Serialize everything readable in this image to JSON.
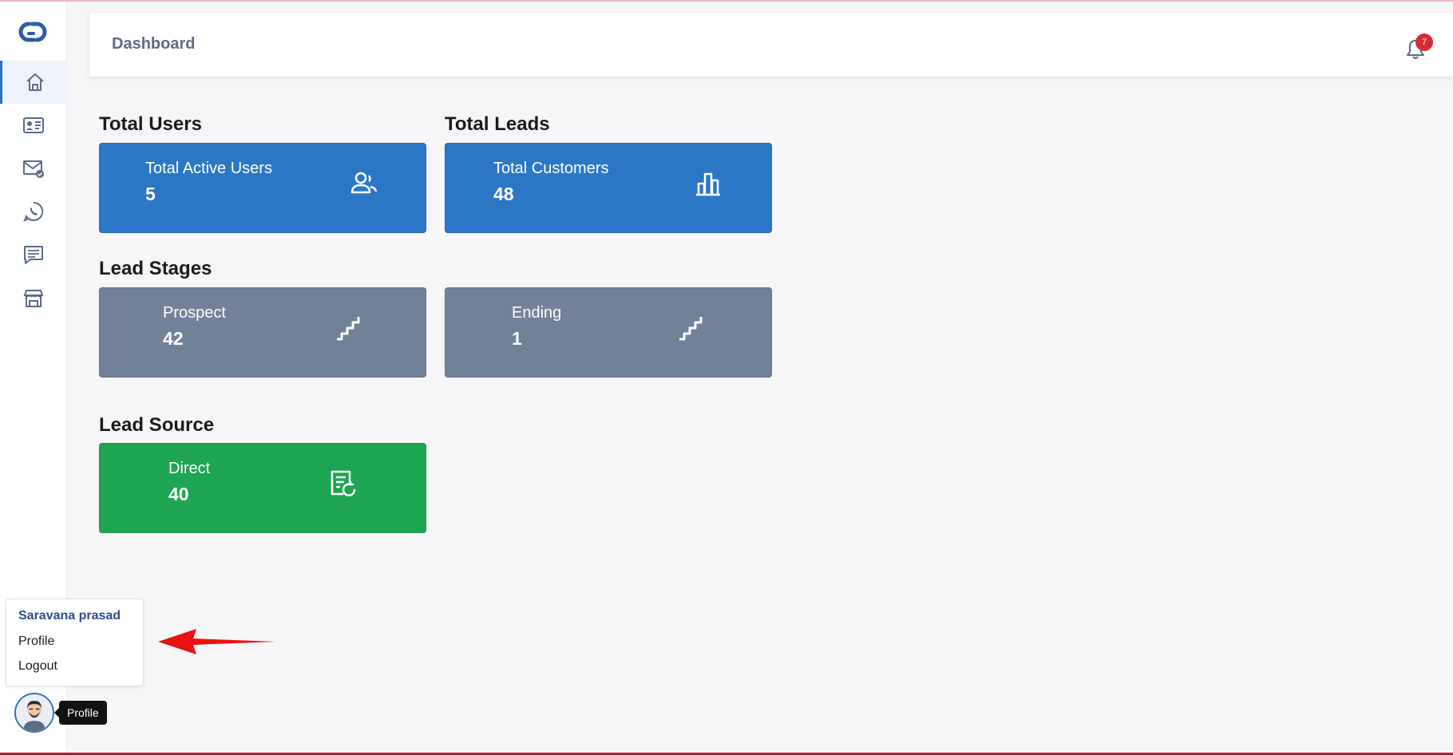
{
  "header": {
    "title": "Dashboard",
    "notification_count": "7"
  },
  "sidebar": {
    "items": [
      {
        "name": "home",
        "icon": "home-icon",
        "active": true
      },
      {
        "name": "contacts",
        "icon": "contact-card-icon",
        "active": false
      },
      {
        "name": "email",
        "icon": "mail-check-icon",
        "active": false
      },
      {
        "name": "whatsapp",
        "icon": "whatsapp-icon",
        "active": false
      },
      {
        "name": "messages",
        "icon": "chat-icon",
        "active": false
      },
      {
        "name": "store",
        "icon": "store-icon",
        "active": false
      }
    ]
  },
  "sections": {
    "total_users": "Total Users",
    "total_leads": "Total Leads",
    "lead_stages": "Lead Stages",
    "lead_source": "Lead Source"
  },
  "cards": {
    "active_users": {
      "label": "Total Active Users",
      "value": "5",
      "icon": "users-icon",
      "color": "#2b77c6"
    },
    "customers": {
      "label": "Total Customers",
      "value": "48",
      "icon": "bar-chart-icon",
      "color": "#2b77c6"
    },
    "prospect": {
      "label": "Prospect",
      "value": "42",
      "icon": "stairs-icon",
      "color": "#71819a"
    },
    "ending": {
      "label": "Ending",
      "value": "1",
      "icon": "stairs-icon",
      "color": "#71819a"
    },
    "direct": {
      "label": "Direct",
      "value": "40",
      "icon": "document-refresh-icon",
      "color": "#1ea552"
    }
  },
  "profile_menu": {
    "user_name": "Saravana prasad",
    "items": [
      "Profile",
      "Logout"
    ]
  },
  "avatar_tooltip": "Profile",
  "colors": {
    "accent": "#2b77c6",
    "arrow": "#e81212",
    "badge": "#d62c3a"
  }
}
